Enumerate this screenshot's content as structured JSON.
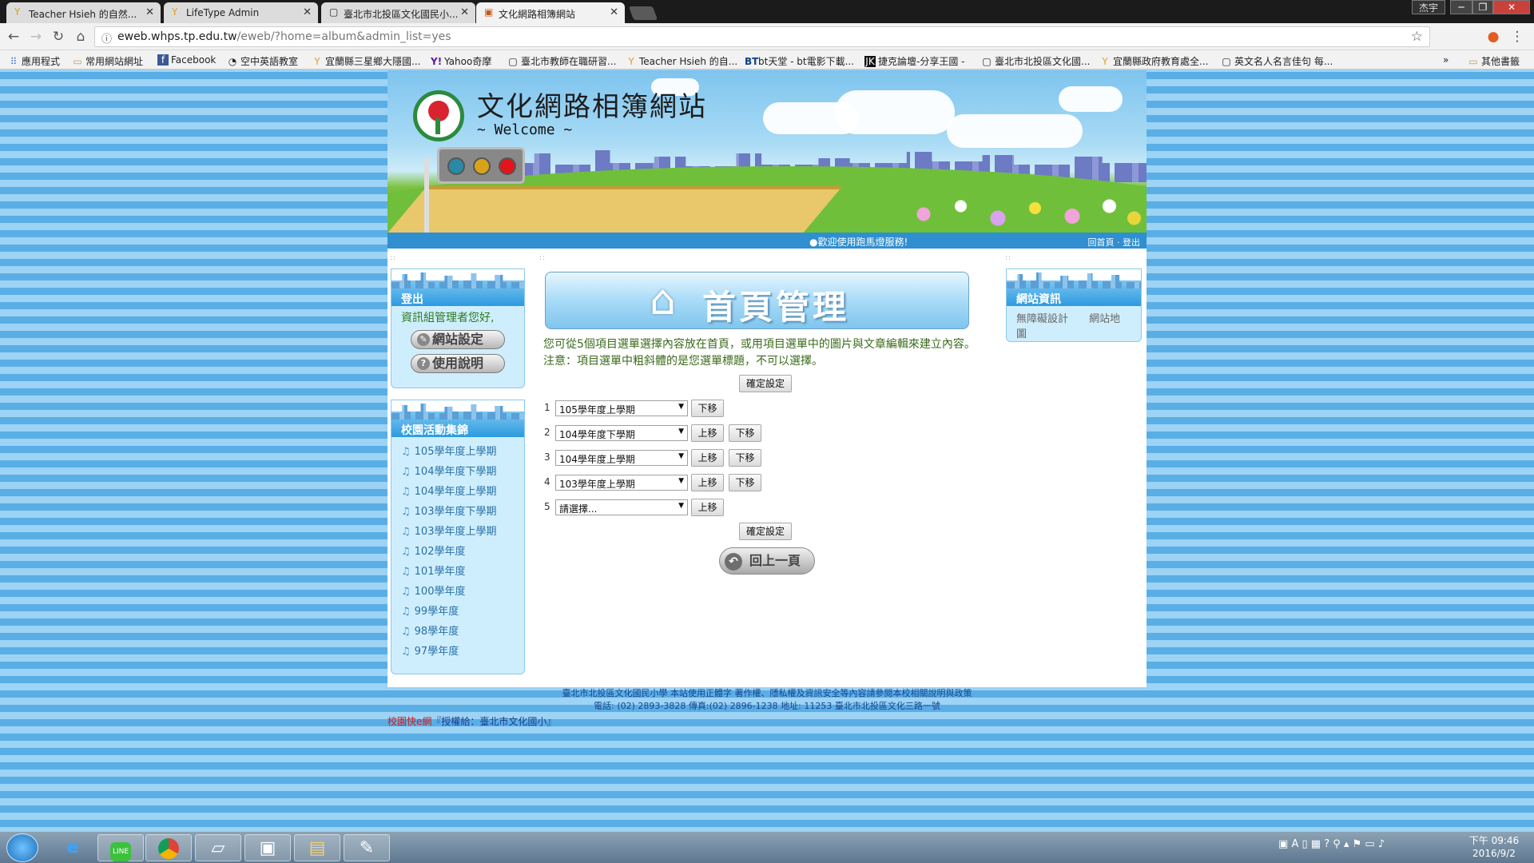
{
  "browser": {
    "tabs": [
      {
        "label": "Teacher Hsieh 的自然...",
        "icon": "y-leaf-icon",
        "active": false
      },
      {
        "label": "LifeType Admin",
        "icon": "y-leaf-icon",
        "active": false
      },
      {
        "label": "臺北市北投區文化國民小...",
        "icon": "page-icon",
        "active": false
      },
      {
        "label": "文化網路相簿網站",
        "icon": "album-icon",
        "active": true
      }
    ],
    "window_user": "杰宇",
    "url_host": "eweb.whps.tp.edu.tw",
    "url_path": "/eweb/?home=album&admin_list=yes",
    "bookmarks": [
      {
        "label": "應用程式",
        "icon": "apps-grid-icon"
      },
      {
        "label": "常用網站網址",
        "icon": "folder-icon"
      },
      {
        "label": "Facebook",
        "icon": "facebook-icon"
      },
      {
        "label": "空中英語教室",
        "icon": "ez-icon"
      },
      {
        "label": "宜蘭縣三星鄉大隱國...",
        "icon": "y-leaf-icon"
      },
      {
        "label": "Yahoo奇摩",
        "icon": "yahoo-icon"
      },
      {
        "label": "臺北市教師在職研習...",
        "icon": "page-icon"
      },
      {
        "label": "Teacher Hsieh 的自...",
        "icon": "y-leaf-icon"
      },
      {
        "label": "bt天堂 - bt電影下載...",
        "icon": "bt-icon"
      },
      {
        "label": "捷克論壇-分享王國 -",
        "icon": "jk-icon"
      },
      {
        "label": "臺北市北投區文化國...",
        "icon": "page-icon"
      },
      {
        "label": "宜蘭縣政府教育處全...",
        "icon": "y-leaf-icon"
      },
      {
        "label": "英文名人名言佳句 每...",
        "icon": "page-icon"
      }
    ],
    "bookmarks_more": "»",
    "other_bookmarks": "其他書籤"
  },
  "site": {
    "banner_title": "文化網路相簿網站",
    "banner_subtitle": "~ Welcome ~",
    "welcome_text": "●歡迎使用跑馬燈服務!",
    "top_links": {
      "home": "回首頁",
      "sep": "·",
      "logout": "登出"
    }
  },
  "left_sidebar": {
    "login_box": {
      "title": "登出",
      "greeting": "資訊組管理者您好,",
      "buttons": [
        {
          "label": "網站設定",
          "icon": "wrench-icon"
        },
        {
          "label": "使用說明",
          "icon": "help-icon"
        }
      ]
    },
    "activities_box": {
      "title": "校園活動集錦",
      "items": [
        "105學年度上學期",
        "104學年度下學期",
        "104學年度上學期",
        "103學年度下學期",
        "103學年度上學期",
        "102學年度",
        "101學年度",
        "100學年度",
        "99學年度",
        "98學年度",
        "97學年度"
      ]
    }
  },
  "main": {
    "title": "首頁管理",
    "instruction": "您可從5個項目選單選擇內容放在首頁，或用項目選單中的圖片與文章編輯來建立內容。 注意：項目選單中粗斜體的是您選單標題，不可以選擇。",
    "confirm_label": "確定設定",
    "rows": [
      {
        "num": "1",
        "value": "105學年度上學期",
        "up": "",
        "down": "下移"
      },
      {
        "num": "2",
        "value": "104學年度下學期",
        "up": "上移",
        "down": "下移"
      },
      {
        "num": "3",
        "value": "104學年度上學期",
        "up": "上移",
        "down": "下移"
      },
      {
        "num": "4",
        "value": "103學年度上學期",
        "up": "上移",
        "down": "下移"
      },
      {
        "num": "5",
        "value": "請選擇...",
        "up": "上移",
        "down": ""
      }
    ],
    "back_label": "回上一頁"
  },
  "right_sidebar": {
    "title": "網站資訊",
    "links": [
      "無障礙設計",
      "網站地圖"
    ]
  },
  "footer": {
    "line1": "臺北市北投區文化國民小學 本站使用正體字 著作權、隱私權及資訊安全等內容請參閱本校相關說明與政策",
    "line2": "電話: (02) 2893-3828 傳真:(02) 2896-1238 地址: 11253 臺北市北投區文化三路一號",
    "credit_red": "校園快e網",
    "credit_blue": "『授權給：臺北市文化國小』"
  },
  "taskbar": {
    "time": "下午 09:46",
    "date": "2016/9/2",
    "apps": [
      "start-orb-icon",
      "internet-explorer-icon",
      "line-icon",
      "chrome-icon",
      "notes-icon",
      "picture-viewer-icon",
      "file-explorer-icon",
      "paint-icon"
    ]
  }
}
